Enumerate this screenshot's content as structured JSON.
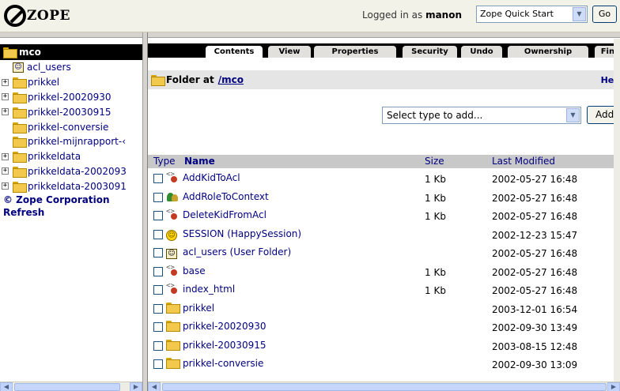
{
  "header": {
    "logo_text": "ZOPE",
    "logged_in_prefix": "Logged in as",
    "username": "manon",
    "quickstart_select": "Zope Quick Start",
    "go_label": "Go"
  },
  "tree": {
    "root": "mco",
    "items": [
      {
        "label": "acl_users",
        "icon": "user-folder-icon",
        "expandable": false
      },
      {
        "label": "prikkel",
        "icon": "folder-icon",
        "expandable": true
      },
      {
        "label": "prikkel-20020930",
        "icon": "folder-icon",
        "expandable": true
      },
      {
        "label": "prikkel-20030915",
        "icon": "folder-icon",
        "expandable": true
      },
      {
        "label": "prikkel-conversie",
        "icon": "folder-icon",
        "expandable": false
      },
      {
        "label": "prikkel-mijnrapport-‹",
        "icon": "folder-icon",
        "expandable": false
      },
      {
        "label": "prikkeldata",
        "icon": "folder-icon",
        "expandable": true
      },
      {
        "label": "prikkeldata-2002093",
        "icon": "folder-icon",
        "expandable": true
      },
      {
        "label": "prikkeldata-2003091",
        "icon": "folder-icon",
        "expandable": true
      }
    ],
    "copyright": "© Zope Corporation",
    "refresh": "Refresh"
  },
  "tabs": [
    "Contents",
    "View",
    "Properties",
    "Security",
    "Undo",
    "Ownership",
    "Find"
  ],
  "active_tab": "Contents",
  "location": {
    "prefix": "Folder at",
    "path": "/mco",
    "help": "Hel"
  },
  "add": {
    "select_label": "Select type to add...",
    "button": "Add"
  },
  "list": {
    "headers": {
      "type": "Type",
      "name": "Name",
      "size": "Size",
      "modified": "Last Modified"
    },
    "rows": [
      {
        "icon": "dtml-method-icon",
        "name": "AddKidToAcl",
        "size": "1 Kb",
        "modified": "2002-05-27 16:48"
      },
      {
        "icon": "proxy-role-icon",
        "name": "AddRoleToContext",
        "size": "1 Kb",
        "modified": "2002-05-27 16:48"
      },
      {
        "icon": "dtml-method-icon",
        "name": "DeleteKidFromAcl",
        "size": "1 Kb",
        "modified": "2002-05-27 16:48"
      },
      {
        "icon": "session-icon",
        "name": "SESSION (HappySession)",
        "size": "",
        "modified": "2002-12-23 15:47"
      },
      {
        "icon": "user-folder-icon",
        "name": "acl_users (User Folder)",
        "size": "",
        "modified": "2002-05-27 16:48"
      },
      {
        "icon": "dtml-method-icon",
        "name": "base",
        "size": "1 Kb",
        "modified": "2002-05-27 16:48"
      },
      {
        "icon": "dtml-method-icon",
        "name": "index_html",
        "size": "1 Kb",
        "modified": "2002-05-27 16:48"
      },
      {
        "icon": "folder-icon",
        "name": "prikkel",
        "size": "",
        "modified": "2003-12-01 16:54"
      },
      {
        "icon": "folder-icon",
        "name": "prikkel-20020930",
        "size": "",
        "modified": "2002-09-30 13:49"
      },
      {
        "icon": "folder-icon",
        "name": "prikkel-20030915",
        "size": "",
        "modified": "2003-08-15 12:48"
      },
      {
        "icon": "folder-icon",
        "name": "prikkel-conversie",
        "size": "",
        "modified": "2002-09-30 13:09"
      }
    ]
  }
}
